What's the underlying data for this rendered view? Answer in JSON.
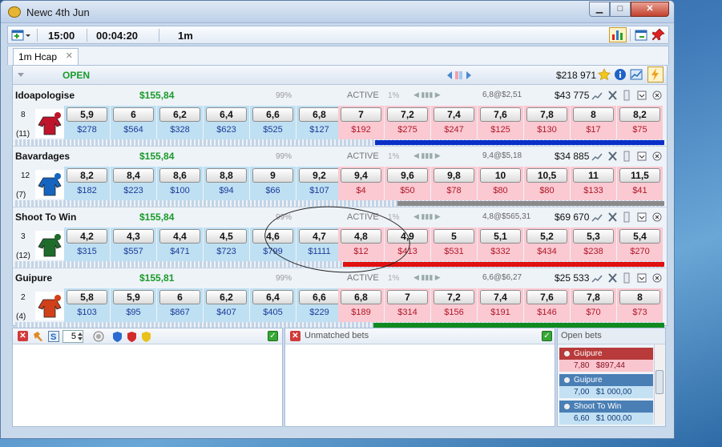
{
  "window": {
    "title": "Newc 4th Jun"
  },
  "toolbar": {
    "time": "15:00",
    "countdown": "00:04:20",
    "interval": "1m"
  },
  "tabs": [
    {
      "label": "1m Hcap"
    }
  ],
  "market": {
    "status": "OPEN",
    "total_matched": "$218 971"
  },
  "runners": [
    {
      "name": "Idoapologise",
      "pl": "$155,84",
      "pct": "99%",
      "state": "ACTIVE",
      "pct2": "1%",
      "ltp": "6,8@$2,51",
      "matched": "$43 775",
      "number": "8",
      "count": "(11)",
      "back": [
        {
          "price": "5,9",
          "amount": "$278"
        },
        {
          "price": "6",
          "amount": "$564"
        },
        {
          "price": "6,2",
          "amount": "$328"
        },
        {
          "price": "6,4",
          "amount": "$623"
        },
        {
          "price": "6,6",
          "amount": "$525"
        },
        {
          "price": "6,8",
          "amount": "$127"
        }
      ],
      "lay": [
        {
          "price": "7",
          "amount": "$192"
        },
        {
          "price": "7,2",
          "amount": "$275"
        },
        {
          "price": "7,4",
          "amount": "$247"
        },
        {
          "price": "7,6",
          "amount": "$125"
        },
        {
          "price": "7,8",
          "amount": "$130"
        },
        {
          "price": "8",
          "amount": "$17"
        },
        {
          "price": "8,2",
          "amount": "$75"
        }
      ],
      "bar_color": "#0a2fc8",
      "silk_color": "#c0142a"
    },
    {
      "name": "Bavardages",
      "pl": "$155,84",
      "pct": "99%",
      "state": "ACTIVE",
      "pct2": "1%",
      "ltp": "9,4@$5,18",
      "matched": "$34 885",
      "number": "12",
      "count": "(7)",
      "back": [
        {
          "price": "8,2",
          "amount": "$182"
        },
        {
          "price": "8,4",
          "amount": "$223"
        },
        {
          "price": "8,6",
          "amount": "$100"
        },
        {
          "price": "8,8",
          "amount": "$94"
        },
        {
          "price": "9",
          "amount": "$66"
        },
        {
          "price": "9,2",
          "amount": "$107"
        }
      ],
      "lay": [
        {
          "price": "9,4",
          "amount": "$4"
        },
        {
          "price": "9,6",
          "amount": "$50"
        },
        {
          "price": "9,8",
          "amount": "$78"
        },
        {
          "price": "10",
          "amount": "$80"
        },
        {
          "price": "10,5",
          "amount": "$80"
        },
        {
          "price": "11",
          "amount": "$133"
        },
        {
          "price": "11,5",
          "amount": "$41"
        }
      ],
      "bar_color": "#8a8a8a",
      "silk_color": "#1565c0"
    },
    {
      "name": "Shoot To Win",
      "pl": "$155,84",
      "pct": "99%",
      "state": "ACTIVE",
      "pct2": "1%",
      "ltp": "4,8@$565,31",
      "matched": "$69 670",
      "number": "3",
      "count": "(12)",
      "back": [
        {
          "price": "4,2",
          "amount": "$315"
        },
        {
          "price": "4,3",
          "amount": "$557"
        },
        {
          "price": "4,4",
          "amount": "$471"
        },
        {
          "price": "4,5",
          "amount": "$723"
        },
        {
          "price": "4,6",
          "amount": "$799"
        },
        {
          "price": "4,7",
          "amount": "$1111"
        }
      ],
      "lay": [
        {
          "price": "4,8",
          "amount": "$12"
        },
        {
          "price": "4,9",
          "amount": "$413"
        },
        {
          "price": "5",
          "amount": "$531"
        },
        {
          "price": "5,1",
          "amount": "$332"
        },
        {
          "price": "5,2",
          "amount": "$434"
        },
        {
          "price": "5,3",
          "amount": "$238"
        },
        {
          "price": "5,4",
          "amount": "$270"
        }
      ],
      "bar_color": "#e01010",
      "silk_color": "#1f6b2c"
    },
    {
      "name": "Guipure",
      "pl": "$155,81",
      "pct": "99%",
      "state": "ACTIVE",
      "pct2": "1%",
      "ltp": "6,6@$6,27",
      "matched": "$25 533",
      "number": "2",
      "count": "(4)",
      "back": [
        {
          "price": "5,8",
          "amount": "$103"
        },
        {
          "price": "5,9",
          "amount": "$95"
        },
        {
          "price": "6",
          "amount": "$867"
        },
        {
          "price": "6,2",
          "amount": "$407"
        },
        {
          "price": "6,4",
          "amount": "$405"
        },
        {
          "price": "6,6",
          "amount": "$229"
        }
      ],
      "lay": [
        {
          "price": "6,8",
          "amount": "$189"
        },
        {
          "price": "7",
          "amount": "$314"
        },
        {
          "price": "7,2",
          "amount": "$156"
        },
        {
          "price": "7,4",
          "amount": "$191"
        },
        {
          "price": "7,6",
          "amount": "$146"
        },
        {
          "price": "7,8",
          "amount": "$70"
        },
        {
          "price": "8",
          "amount": "$73"
        }
      ],
      "bar_color": "#108a20",
      "silk_color": "#d2401a"
    }
  ],
  "bet_panel": {
    "stake_value": "5"
  },
  "unmatched": {
    "title": "Unmatched bets"
  },
  "open_bets": {
    "title": "Open bets",
    "items": [
      {
        "runner": "Guipure",
        "price": "7,80",
        "amount": "$897,44",
        "side": "lay"
      },
      {
        "runner": "Guipure",
        "price": "7,00",
        "amount": "$1 000,00",
        "side": "back"
      },
      {
        "runner": "Shoot To Win",
        "price": "6,60",
        "amount": "$1 000,00",
        "side": "back"
      }
    ]
  }
}
